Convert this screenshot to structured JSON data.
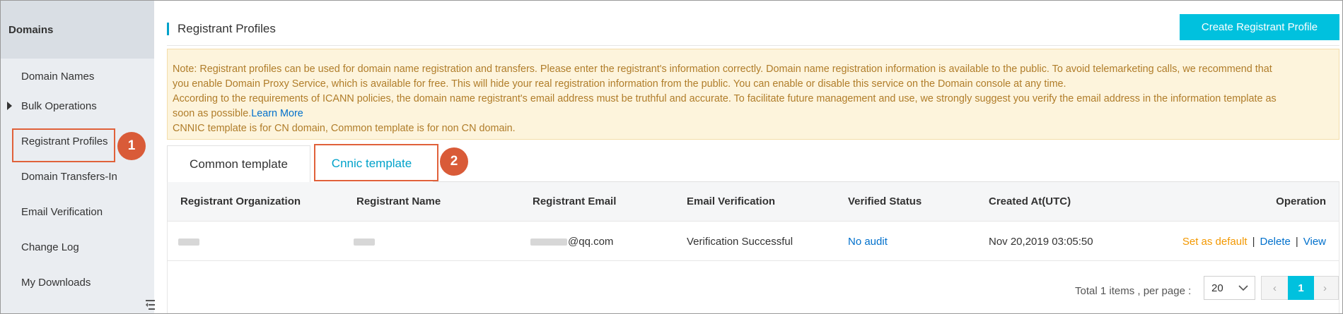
{
  "sidebar": {
    "header": "Domains",
    "items": [
      {
        "label": "Domain Names"
      },
      {
        "label": "Bulk Operations"
      },
      {
        "label": "Registrant Profiles"
      },
      {
        "label": "Domain Transfers-In"
      },
      {
        "label": "Email Verification"
      },
      {
        "label": "Change Log"
      },
      {
        "label": "My Downloads"
      }
    ]
  },
  "header": {
    "title": "Registrant Profiles",
    "create_button": "Create Registrant Profile"
  },
  "note": {
    "line1": "Note: Registrant profiles can be used for domain name registration and transfers. Please enter the registrant's information correctly. Domain name registration information is available to the public. To avoid telemarketing calls, we recommend that",
    "line2": "you enable Domain Proxy Service, which is available for free. This will hide your real registration information from the public. You can enable or disable this service on the Domain console at any time.",
    "line3": "According to the requirements of ICANN policies, the domain name registrant's email address must be truthful and accurate. To facilitate future management and use, we strongly suggest you verify the email address in the information template as",
    "line4": "soon as possible.",
    "learn_more": "Learn More",
    "line5": "CNNIC template is for CN domain, Common template is for non CN domain."
  },
  "tabs": {
    "common": "Common template",
    "cnnic": "Cnnic template"
  },
  "annotations": {
    "step1": "1",
    "step2": "2"
  },
  "table": {
    "columns": [
      "Registrant Organization",
      "Registrant Name",
      "Registrant Email",
      "Email Verification",
      "Verified Status",
      "Created At(UTC)",
      "Operation"
    ],
    "rows": [
      {
        "email_suffix": "@qq.com",
        "email_verification": "Verification Successful",
        "verified_status": "No audit",
        "created_at": "Nov 20,2019 03:05:50",
        "op_default": "Set as default",
        "op_delete": "Delete",
        "op_view": "View",
        "op_separator": "|"
      }
    ]
  },
  "pagination": {
    "total_text": "Total 1 items , per page :",
    "page_size": "20",
    "current_page": "1",
    "prev_glyph": "‹",
    "next_glyph": "›"
  },
  "colors": {
    "accent": "#00c1de",
    "link": "#0070cc",
    "warning_text": "#b07d2a",
    "annotation": "#d95b38"
  }
}
